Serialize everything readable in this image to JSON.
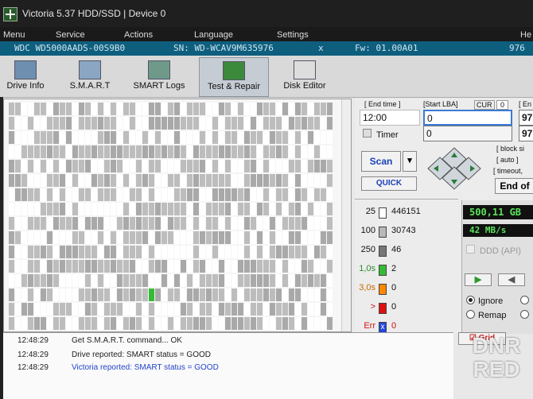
{
  "title": "Victoria 5.37 HDD/SSD | Device 0",
  "menu": [
    "Menu",
    "Service",
    "Actions",
    "Language",
    "Settings",
    "He"
  ],
  "drive": {
    "model": "WDC WD5000AADS-00S9B0",
    "serial": "SN: WD-WCAV9M635976",
    "close": "x",
    "firmware": "Fw: 01.00A01",
    "extra": "976"
  },
  "toolbar": [
    {
      "label": "Drive Info",
      "icon": "info-icon"
    },
    {
      "label": "S.M.A.R.T",
      "icon": "smart-icon"
    },
    {
      "label": "SMART Logs",
      "icon": "logs-icon"
    },
    {
      "label": "Test & Repair",
      "icon": "first-aid-icon"
    },
    {
      "label": "Disk Editor",
      "icon": "binary-icon"
    }
  ],
  "controls": {
    "end_time_label": "[ End time ]",
    "start_lba_label": "[Start LBA]",
    "cur_label": "CUR",
    "cur_value": "0",
    "end_label": "[ En",
    "end_time_value": "12:00",
    "start_lba_value": "0",
    "end_lba_value": "97",
    "timer_label": "Timer",
    "timer_value": "0",
    "timer_right": "97",
    "scan_label": "Scan",
    "quick_label": "QUICK",
    "block_size_label": "[ block si",
    "auto_label": "[ auto ]",
    "timeout_label": "[ timeout,",
    "end_of_label": "End of"
  },
  "legend": [
    {
      "key": "25",
      "count": "446151",
      "color": "#ffffff"
    },
    {
      "key": "100",
      "count": "30743",
      "color": "#b8b8b8"
    },
    {
      "key": "250",
      "count": "46",
      "color": "#777777"
    },
    {
      "key": "1,0s",
      "count": "2",
      "color": "#33bb33"
    },
    {
      "key": "3,0s",
      "count": "0",
      "color": "#ff8800"
    },
    {
      "key": ">",
      "count": "0",
      "color": "#dd1111"
    },
    {
      "key": "Err",
      "count": "0",
      "color": "#2244dd"
    }
  ],
  "stats": {
    "capacity": "500,11 GB",
    "speed": "42 MB/s",
    "ddd": "DDD (API)"
  },
  "actions": {
    "ignore": "Ignore",
    "remap": "Remap",
    "grid": "Grid",
    "selected": "Ignore"
  },
  "log": [
    {
      "time": "12:48:29",
      "msg": "Get S.M.A.R.T. command... OK",
      "style": "normal"
    },
    {
      "time": "12:48:29",
      "msg": "Drive reported: SMART status = GOOD",
      "style": "normal"
    },
    {
      "time": "12:48:29",
      "msg": "Victoria reported: SMART status = GOOD",
      "style": "blue"
    }
  ],
  "watermark": "DNR RED",
  "map": {
    "good": 0.7,
    "slow": 0.3,
    "green_blocks": 1
  }
}
